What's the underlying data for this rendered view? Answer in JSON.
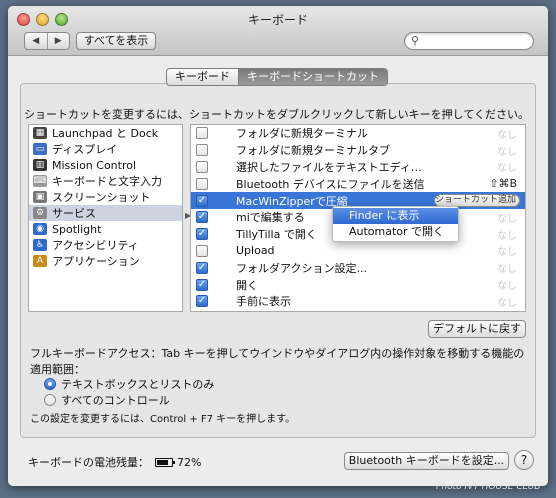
{
  "window": {
    "title": "キーボード"
  },
  "toolbar": {
    "back": "◀",
    "forward": "▶",
    "show_all": "すべてを表示",
    "search_placeholder": ""
  },
  "tabs": [
    {
      "label": "キーボード",
      "active": false
    },
    {
      "label": "キーボードショートカット",
      "active": true
    }
  ],
  "instruction": "ショートカットを変更するには、ショートカットをダブルクリックして新しいキーを押してください。",
  "categories": [
    {
      "label": "Launchpad と Dock",
      "icon": "launchpad-icon",
      "color": "#444444",
      "selected": false
    },
    {
      "label": "ディスプレイ",
      "icon": "display-icon",
      "color": "#3a6fc4",
      "selected": false
    },
    {
      "label": "Mission Control",
      "icon": "mission-control-icon",
      "color": "#333333",
      "selected": false
    },
    {
      "label": "キーボードと文字入力",
      "icon": "keyboard-icon",
      "color": "#9a9a9a",
      "selected": false
    },
    {
      "label": "スクリーンショット",
      "icon": "screenshot-icon",
      "color": "#777777",
      "selected": false
    },
    {
      "label": "サービス",
      "icon": "gear-icon",
      "color": "#8a8a8a",
      "selected": true
    },
    {
      "label": "Spotlight",
      "icon": "spotlight-icon",
      "color": "#2f6bcf",
      "selected": false
    },
    {
      "label": "アクセシビリティ",
      "icon": "accessibility-icon",
      "color": "#2f6bcf",
      "selected": false
    },
    {
      "label": "アプリケーション",
      "icon": "applications-icon",
      "color": "#c98a18",
      "selected": false
    }
  ],
  "services": [
    {
      "label": "フォルダに新規ターミナル",
      "checked": false,
      "shortcut": "なし",
      "selected": false
    },
    {
      "label": "フォルダに新規ターミナルタブ",
      "checked": false,
      "shortcut": "なし",
      "selected": false
    },
    {
      "label": "選択したファイルをテキストエディ…",
      "checked": false,
      "shortcut": "なし",
      "selected": false
    },
    {
      "label": "Bluetooth デバイスにファイルを送信",
      "checked": false,
      "shortcut": "⇧⌘B",
      "selected": false
    },
    {
      "label": "MacWinZipperで圧縮",
      "checked": true,
      "shortcut": "ショートカット追加",
      "selected": true
    },
    {
      "label": "miで編集する",
      "checked": true,
      "shortcut": "なし",
      "selected": false
    },
    {
      "label": "TillyTilla で開く",
      "checked": true,
      "shortcut": "なし",
      "selected": false
    },
    {
      "label": "Upload",
      "checked": false,
      "shortcut": "なし",
      "selected": false
    },
    {
      "label": "フォルダアクション設定...",
      "checked": true,
      "shortcut": "なし",
      "selected": false
    },
    {
      "label": "開く",
      "checked": true,
      "shortcut": "なし",
      "selected": false
    },
    {
      "label": "手前に表示",
      "checked": true,
      "shortcut": "なし",
      "selected": false
    }
  ],
  "context_menu": [
    {
      "label": "Finder に表示",
      "highlighted": true
    },
    {
      "label": "Automator で開く",
      "highlighted": false
    }
  ],
  "restore_defaults_label": "デフォルトに戻す",
  "full_keyboard_access": {
    "text": "フルキーボードアクセス：Tab キーを押してウインドウやダイアログ内の操作対象を移動する機能の適用範囲：",
    "options": [
      {
        "label": "テキストボックスとリストのみ",
        "selected": true
      },
      {
        "label": "すべてのコントロール",
        "selected": false
      }
    ],
    "note": "この設定を変更するには、Control + F7 キーを押します。"
  },
  "battery": {
    "label": "キーボードの電池残量：",
    "level": "72%"
  },
  "bluetooth_button_label": "Bluetooth キーボードを設定...",
  "help_label": "?",
  "watermark": "Photo IVY HOUSE CLUB"
}
